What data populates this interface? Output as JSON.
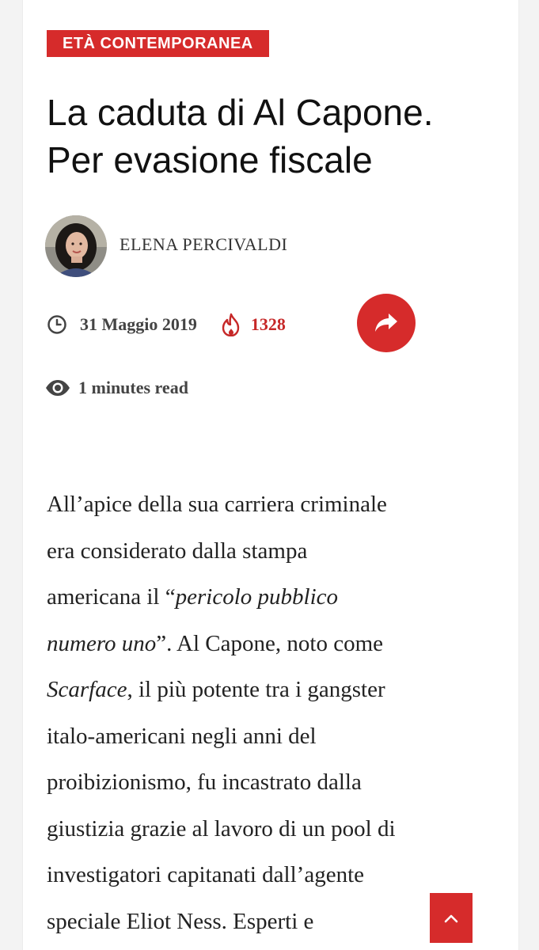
{
  "category": "ETÀ CONTEMPORANEA",
  "title": {
    "line1": "La caduta di Al Capone.",
    "line2": "Per evasione fiscale"
  },
  "author": {
    "name": "ELENA PERCIVALDI",
    "avatar_icon": "author-avatar"
  },
  "meta": {
    "date": "31 Maggio 2019",
    "views": "1328",
    "read_time": "1 minutes read",
    "icons": {
      "date": "clock-icon",
      "views": "fire-icon",
      "share": "share-arrow-icon",
      "read": "eye-icon"
    }
  },
  "article": {
    "lines": [
      "All’apice della sua carriera criminale",
      "era considerato dalla stampa",
      "americana il “pericolo pubblico",
      "numero uno”. Al Capone, noto come",
      "Scarface, il più potente tra i gangster",
      "italo-americani negli anni del",
      "proibizionismo, fu incastrato dalla",
      "giustizia grazie al lavoro di un pool di",
      "investigatori capitanati dall’agente",
      "speciale Eliot Ness. Esperti e"
    ],
    "seg": {
      "l3a": "americana il “",
      "l3b": "pericolo pubblico",
      "l4a": "numero uno",
      "l4b": "”. Al Capone, noto come",
      "l5a": "Scarface",
      "l5b": ", il più potente tra i gangster"
    }
  },
  "colors": {
    "accent": "#d62b2b",
    "views": "#c62828",
    "text": "#222222",
    "meta": "#444444"
  },
  "scroll_top_icon": "chevron-up-icon"
}
